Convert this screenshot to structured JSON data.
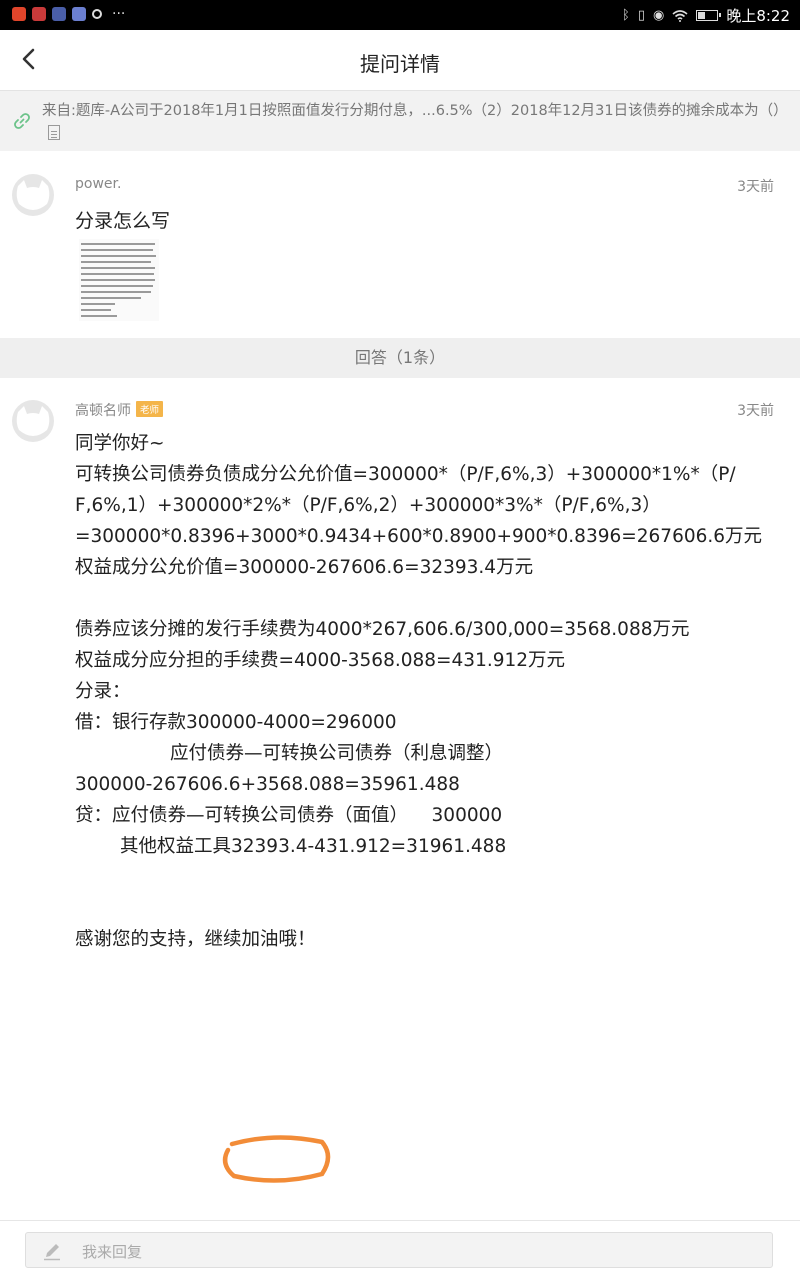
{
  "status_bar": {
    "time": "晚上8:22",
    "battery_level": 0.4,
    "notification_icons": [
      "video-app-icon",
      "red-app-icon",
      "mail-app-icon",
      "music-app-icon",
      "circle-app-icon"
    ]
  },
  "nav": {
    "title": "提问详情"
  },
  "source": {
    "text": "来自:题库-A公司于2018年1月1日按照面值发行分期付息，...6.5%（2）2018年12月31日该债券的摊余成本为（）"
  },
  "question": {
    "user": "power.",
    "time": "3天前",
    "content": "分录怎么写"
  },
  "answers_header": "回答（1条）",
  "answer": {
    "user": "高顿名师",
    "badge": "老师",
    "time": "3天前",
    "lines": {
      "l1": "同学你好~",
      "l2": "可转换公司债券负债成分公允价值=300000*（P/F,6%,3）+300000*1%*（P/",
      "l3": "F,6%,1）+300000*2%*（P/F,6%,2）+300000*3%*（P/F,6%,3）",
      "l4": "=300000*0.8396+3000*0.9434+600*0.8900+900*0.8396=267606.6万元",
      "l5": "权益成分公允价值=300000-267606.6=32393.4万元",
      "l6": "债券应该分摊的发行手续费为4000*267,606.6/300,000=3568.088万元",
      "l7": "权益成分应分担的手续费=4000-3568.088=431.912万元",
      "l8": "分录：",
      "l9": "借：银行存款300000-4000=296000",
      "l10": "应付债券—可转换公司债券（利息调整）",
      "l11": "300000-267606.6+3568.088=35961.488",
      "l12": "贷：应付债券—可转换公司债券（面值）    300000",
      "l13": "其他权益工具32393.4-431.912=31961.488",
      "l14": "感谢您的支持，继续加油哦！"
    },
    "highlight_color": "#f28c38"
  },
  "reply": {
    "placeholder": "我来回复"
  }
}
